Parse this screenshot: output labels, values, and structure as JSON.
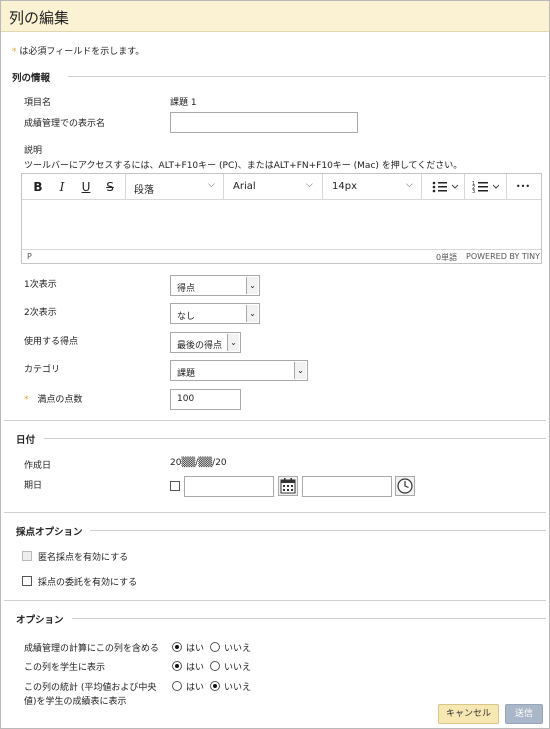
{
  "dialog": {
    "title": "列の編集"
  },
  "required_note": {
    "star": "*",
    "text": "は必須フィールドを示します。"
  },
  "column_info": {
    "heading": "列の情報",
    "item_name_label": "項目名",
    "item_name_value": "課題 1",
    "display_name_label": "成績管理での表示名",
    "display_name_value": "",
    "description_label": "説明",
    "description_help": "ツールバーにアクセスするには、ALT+F10キー (PC)、またはALT+FN+F10キー (Mac) を押してください。"
  },
  "editor": {
    "bold": "B",
    "italic": "I",
    "underline": "U",
    "strike": "S",
    "paragraph": "段落",
    "font": "Arial",
    "size": "14px",
    "more": "•••",
    "path": "P",
    "wordcount": "0単語",
    "powered": "POWERED BY TINY"
  },
  "primary_display": {
    "label": "1次表示",
    "value": "得点"
  },
  "secondary_display": {
    "label": "2次表示",
    "value": "なし"
  },
  "score_used": {
    "label": "使用する得点",
    "value": "最後の得点"
  },
  "category": {
    "label": "カテゴリ",
    "value": "課題"
  },
  "points_possible": {
    "star": "*",
    "label": "満点の点数",
    "value": "100"
  },
  "dates": {
    "heading": "日付",
    "created_label": "作成日",
    "created_value": "20▒▒/▒▒/20",
    "due_label": "期日",
    "due_date_value": "",
    "due_time_value": ""
  },
  "grading_options": {
    "heading": "採点オプション",
    "anonymous": "匿名採点を有効にする",
    "delegate": "採点の委託を有効にする"
  },
  "options": {
    "heading": "オプション",
    "include_calc": {
      "label": "成績管理の計算にこの列を含める",
      "yes": "はい",
      "no": "いいえ",
      "selected": "yes"
    },
    "show_students": {
      "label": "この列を学生に表示",
      "yes": "はい",
      "no": "いいえ",
      "selected": "yes"
    },
    "show_stats": {
      "label_line1": "この列の統計 (平均値および中央",
      "label_line2": "値)を学生の成績表に表示",
      "yes": "はい",
      "no": "いいえ",
      "selected": "no"
    }
  },
  "footer": {
    "cancel": "キャンセル",
    "submit": "送信"
  },
  "colors": {
    "header_bg": "#fbf1d3",
    "required_star": "#e0a030",
    "cancel_bg": "#f7e7b3",
    "submit_bg": "#a9b7c9"
  }
}
